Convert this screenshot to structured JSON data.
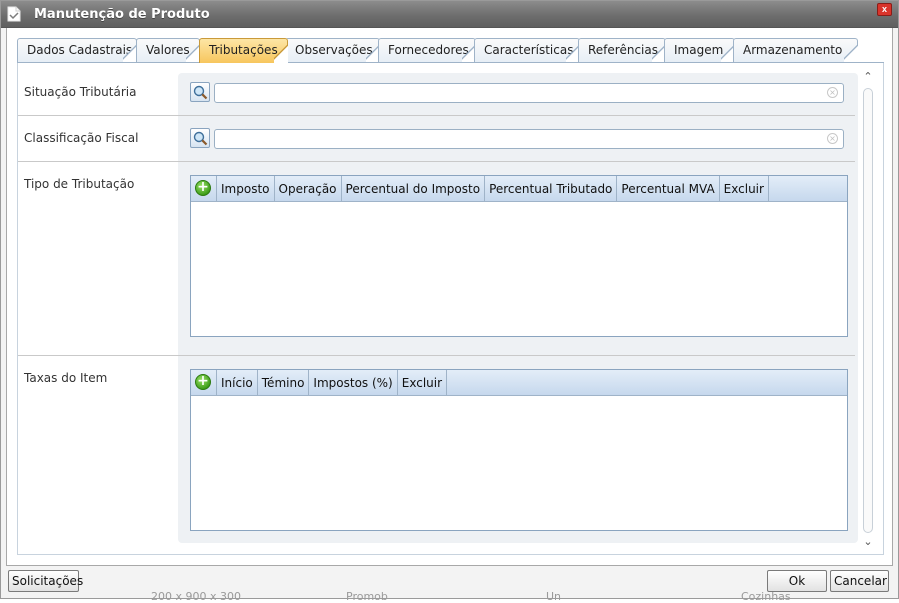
{
  "window": {
    "title": "Manutenção de Produto",
    "close_label": "x"
  },
  "tabs": [
    {
      "label": "Dados Cadastrais",
      "active": false
    },
    {
      "label": "Valores",
      "active": false
    },
    {
      "label": "Tributações",
      "active": true
    },
    {
      "label": "Observações",
      "active": false
    },
    {
      "label": "Fornecedores",
      "active": false
    },
    {
      "label": "Características",
      "active": false
    },
    {
      "label": "Referências",
      "active": false
    },
    {
      "label": "Imagem",
      "active": false
    },
    {
      "label": "Armazenamento",
      "active": false
    }
  ],
  "form": {
    "situacao_label": "Situação Tributária",
    "situacao_value": "",
    "classificacao_label": "Classificação Fiscal",
    "classificacao_value": "",
    "tipo_label": "Tipo de Tributação",
    "taxas_label": "Taxas do Item"
  },
  "tipo_grid": {
    "columns": [
      "Imposto",
      "Operação",
      "Percentual do Imposto",
      "Percentual Tributado",
      "Percentual MVA",
      "Excluir"
    ],
    "rows": []
  },
  "taxas_grid": {
    "columns": [
      "Início",
      "Témino",
      "Impostos (%)",
      "Excluir"
    ],
    "rows": []
  },
  "footer": {
    "solicitacoes_label": "Solicitações",
    "ok_label": "Ok",
    "cancelar_label": "Cancelar"
  },
  "background_text": [
    "200 x 900 x 300",
    "Promob",
    "Un",
    "Cozinhas"
  ],
  "colors": {
    "active_tab": "#f7c65d",
    "add_button": "#3a9a16",
    "close_button": "#d9342b"
  }
}
